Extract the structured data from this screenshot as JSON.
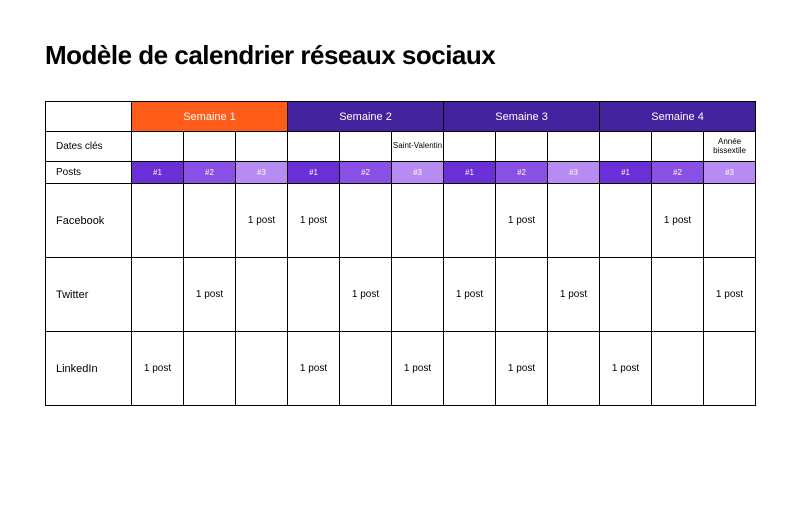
{
  "title": "Modèle de calendrier réseaux sociaux",
  "weeks": [
    "Semaine 1",
    "Semaine 2",
    "Semaine 3",
    "Semaine 4"
  ],
  "rows": {
    "dates_label": "Dates clés",
    "posts_label": "Posts"
  },
  "key_dates": [
    [
      "",
      "",
      ""
    ],
    [
      "",
      "",
      "Saint-Valentin"
    ],
    [
      "",
      "",
      ""
    ],
    [
      "",
      "",
      "Année bissextile"
    ]
  ],
  "post_slots": [
    "#1",
    "#2",
    "#3"
  ],
  "platforms": [
    {
      "name": "Facebook",
      "weeks": [
        [
          "",
          "",
          "1 post"
        ],
        [
          "1 post",
          "",
          ""
        ],
        [
          "",
          "1 post",
          ""
        ],
        [
          "",
          "1 post",
          ""
        ]
      ]
    },
    {
      "name": "Twitter",
      "weeks": [
        [
          "",
          "1 post",
          ""
        ],
        [
          "",
          "1 post",
          ""
        ],
        [
          "1 post",
          "",
          "1 post"
        ],
        [
          "",
          "",
          "1 post"
        ]
      ]
    },
    {
      "name": "LinkedIn",
      "weeks": [
        [
          "1 post",
          "",
          ""
        ],
        [
          "1 post",
          "",
          "1 post"
        ],
        [
          "",
          "1 post",
          ""
        ],
        [
          "1 post",
          "",
          ""
        ]
      ]
    }
  ],
  "colors": {
    "week1_header": "#ff5c1a",
    "week_purple": "#43229e",
    "slot1": "#6a2fd6",
    "slot2": "#8a50e6",
    "slot3": "#b68cf2"
  }
}
